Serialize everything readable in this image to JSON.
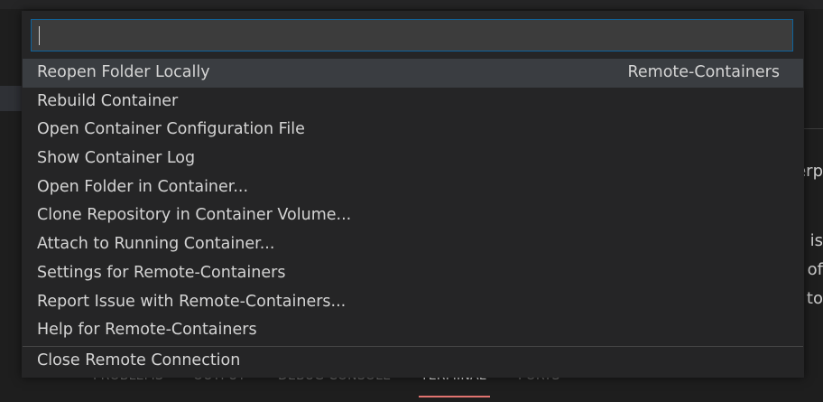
{
  "quick_pick": {
    "input_value": "",
    "items": [
      {
        "label": "Reopen Folder Locally",
        "detail": "Remote-Containers",
        "selected": true
      },
      {
        "label": "Rebuild Container",
        "detail": ""
      },
      {
        "label": "Open Container Configuration File",
        "detail": ""
      },
      {
        "label": "Show Container Log",
        "detail": ""
      },
      {
        "label": "Open Folder in Container...",
        "detail": ""
      },
      {
        "label": "Clone Repository in Container Volume...",
        "detail": ""
      },
      {
        "label": "Attach to Running Container...",
        "detail": ""
      },
      {
        "label": "Settings for Remote-Containers",
        "detail": ""
      },
      {
        "label": "Report Issue with Remote-Containers...",
        "detail": ""
      },
      {
        "label": "Help for Remote-Containers",
        "detail": ""
      },
      {
        "label": "Close Remote Connection",
        "detail": ""
      }
    ]
  },
  "background": {
    "right_text": [
      "erp",
      "is",
      "of",
      "to"
    ],
    "panel_tabs": [
      "PROBLEMS",
      "OUTPUT",
      "DEBUG CONSOLE",
      "TERMINAL",
      "PORTS"
    ],
    "active_tab": "TERMINAL"
  },
  "colors": {
    "input_border": "#0e639c",
    "selected_row": "#3a3d41",
    "active_tab_underline": "#e0736f"
  }
}
